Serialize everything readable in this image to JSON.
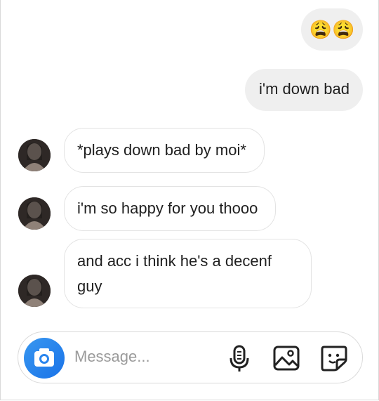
{
  "messages": [
    {
      "direction": "outgoing",
      "text": "😩😩"
    },
    {
      "direction": "outgoing",
      "text": "i'm down bad"
    },
    {
      "direction": "incoming",
      "text": "*plays down bad by moi*"
    },
    {
      "direction": "incoming",
      "text": "i'm so happy for you thooo"
    },
    {
      "direction": "incoming",
      "lines": [
        "and acc i think he's a decenf",
        "guy"
      ]
    }
  ],
  "composer": {
    "placeholder": "Message...",
    "icons": [
      "camera-icon",
      "microphone-icon",
      "gallery-icon",
      "sticker-icon"
    ]
  },
  "colors": {
    "outgoing_bubble": "#efefef",
    "accent": "#3897f0"
  }
}
